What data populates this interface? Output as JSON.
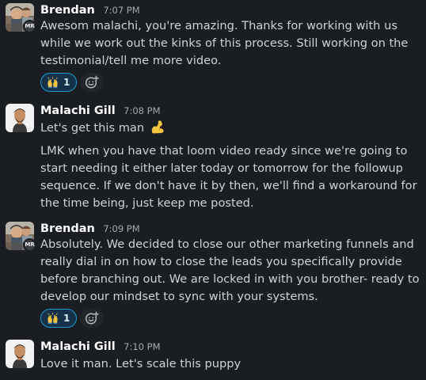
{
  "messages": [
    {
      "author": "Brendan",
      "time": "7:07 PM",
      "avatar_badge": "MR",
      "paragraphs": [
        "Awesom malachi, you're amazing. Thanks for working with us while we work out the kinks of this process. Still working on the testimonial/tell me more video."
      ],
      "reaction": {
        "emoji": "raised-hands-icon",
        "count": "1"
      }
    },
    {
      "author": "Malachi Gill",
      "time": "7:08 PM",
      "paragraphs": [
        "Let's get this man",
        "LMK when you have that loom video ready since we're going to start needing it either later today or tomorrow for the followup sequence. If we don't have it by then, we'll find a workaround for the time being, just keep me posted."
      ],
      "first_line_emoji": "flexed-biceps-icon"
    },
    {
      "author": "Brendan",
      "time": "7:09 PM",
      "avatar_badge": "MR",
      "paragraphs": [
        "Absolutely. We decided to close our other marketing funnels and really dial in on how to close the leads you specifically provide before branching out. We are locked in with you brother- ready to develop our mindset to sync with your systems."
      ],
      "reaction": {
        "emoji": "raised-hands-icon",
        "count": "1"
      }
    },
    {
      "author": "Malachi Gill",
      "time": "7:10 PM",
      "paragraphs": [
        "Love it man. Let's scale this puppy"
      ]
    }
  ],
  "colors": {
    "background": "#1a1d21",
    "text": "#d1d2d3",
    "name": "#ffffff",
    "timestamp": "#a7a8aa",
    "reaction_bg": "#16314a",
    "reaction_border": "#1d9bd1"
  }
}
